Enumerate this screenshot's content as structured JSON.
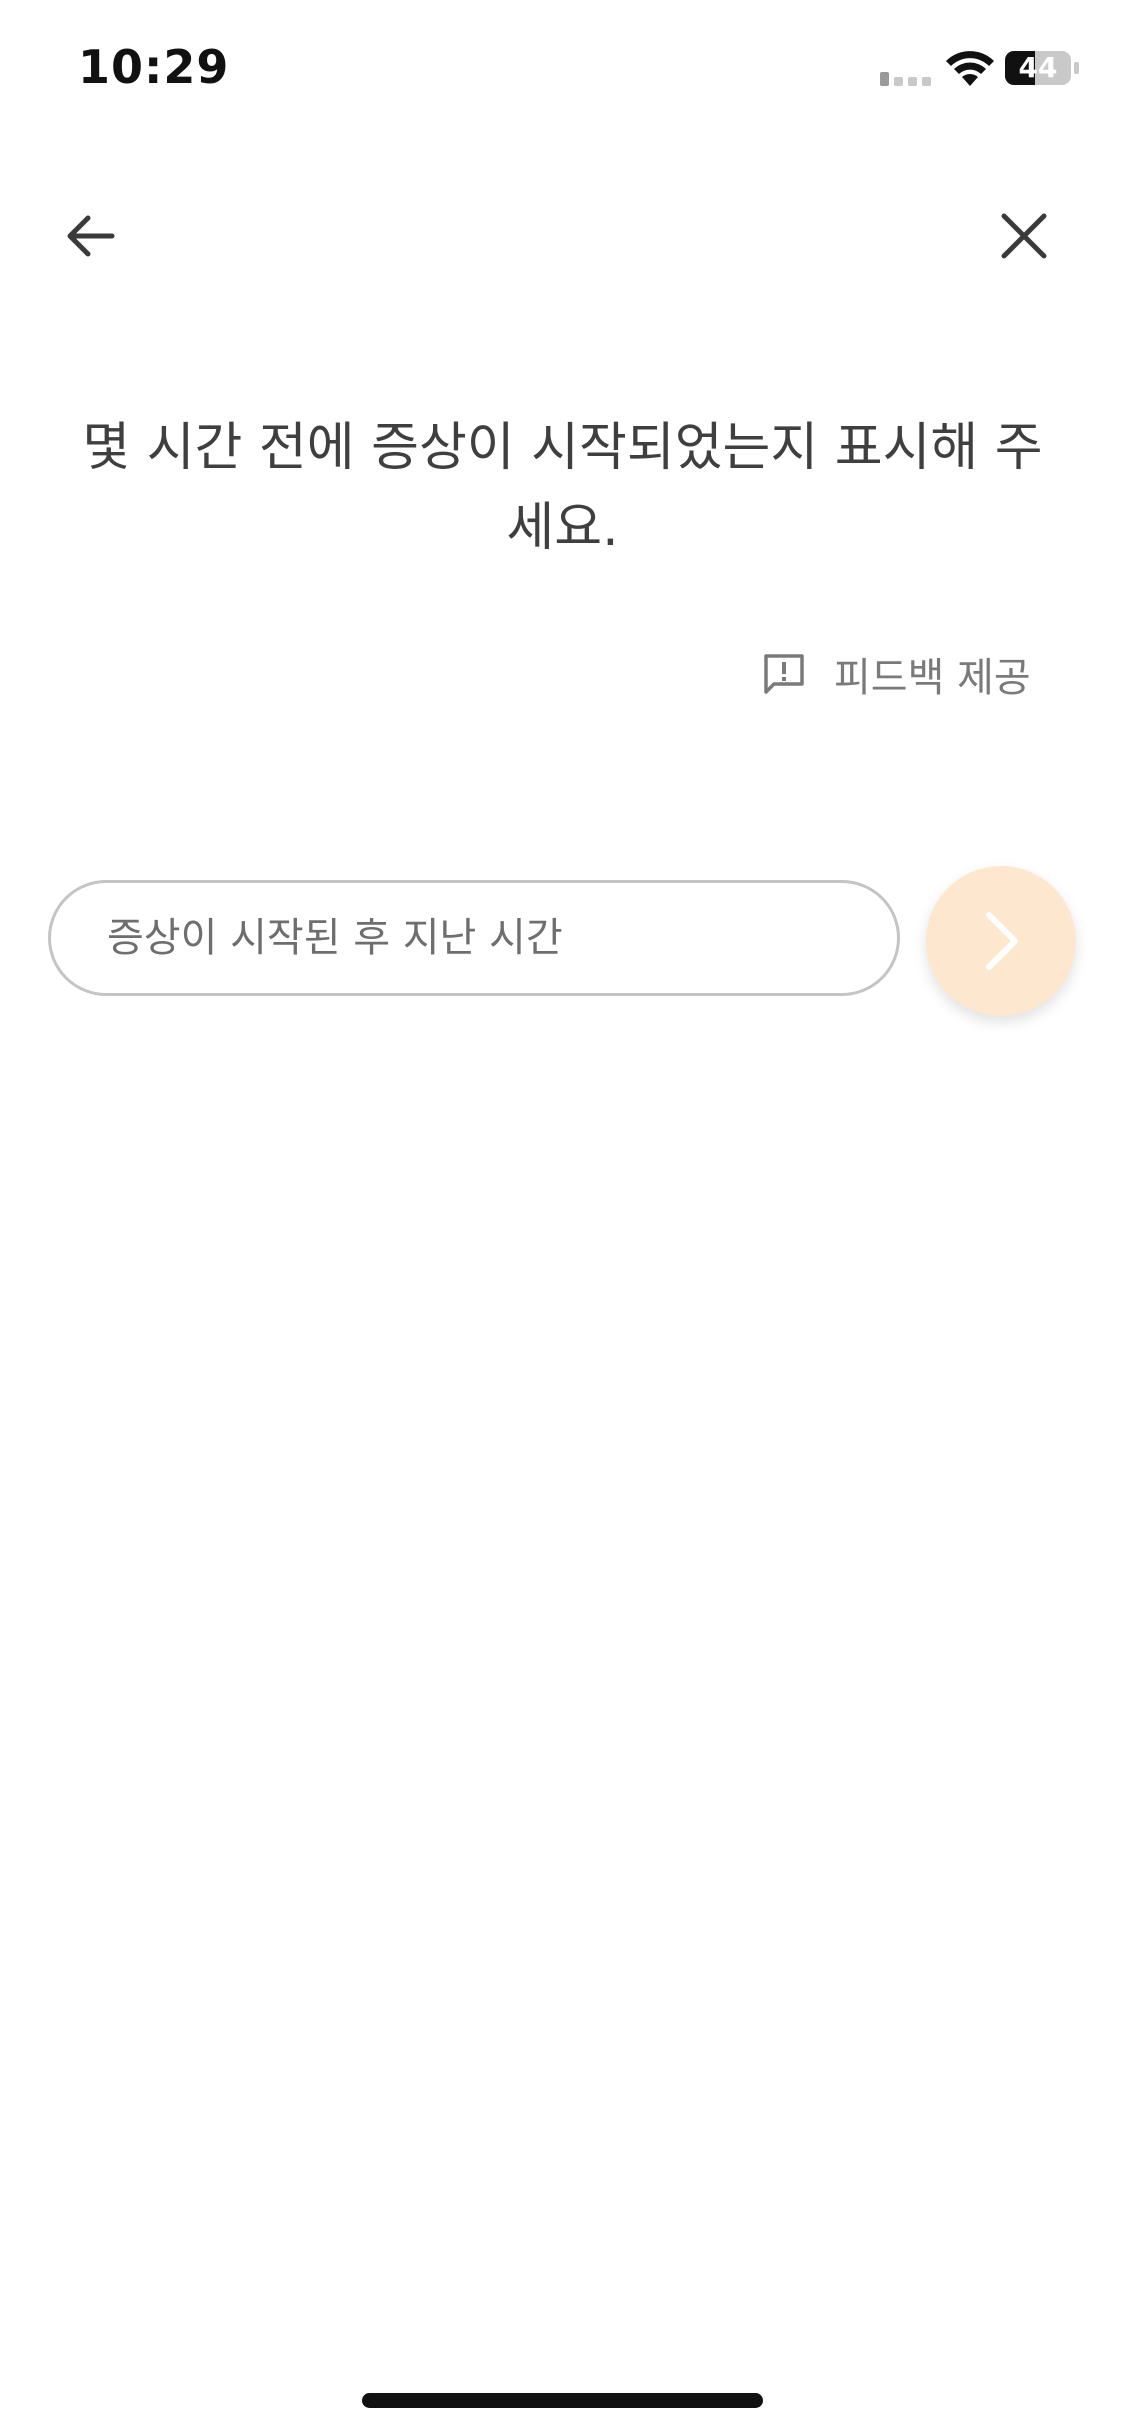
{
  "status_bar": {
    "time": "10:29",
    "battery_level": "44",
    "icons": [
      "signal-icon",
      "wifi-icon",
      "battery-icon"
    ]
  },
  "nav": {
    "back_icon": "arrow-left-icon",
    "close_icon": "close-icon"
  },
  "question": {
    "text": "몇 시간 전에 증상이 시작되었는지 표시해 주세요."
  },
  "feedback": {
    "icon": "feedback-icon",
    "label": "피드백 제공"
  },
  "answer": {
    "placeholder": "증상이 시작된 후 지난 시간",
    "value": ""
  },
  "next_button": {
    "icon": "chevron-right-icon",
    "enabled": false
  },
  "colors": {
    "accent_disabled": "#fde8cf",
    "text_primary": "#3f3f3f",
    "text_secondary": "#7a7a7a",
    "input_border": "#c4c4c4"
  }
}
